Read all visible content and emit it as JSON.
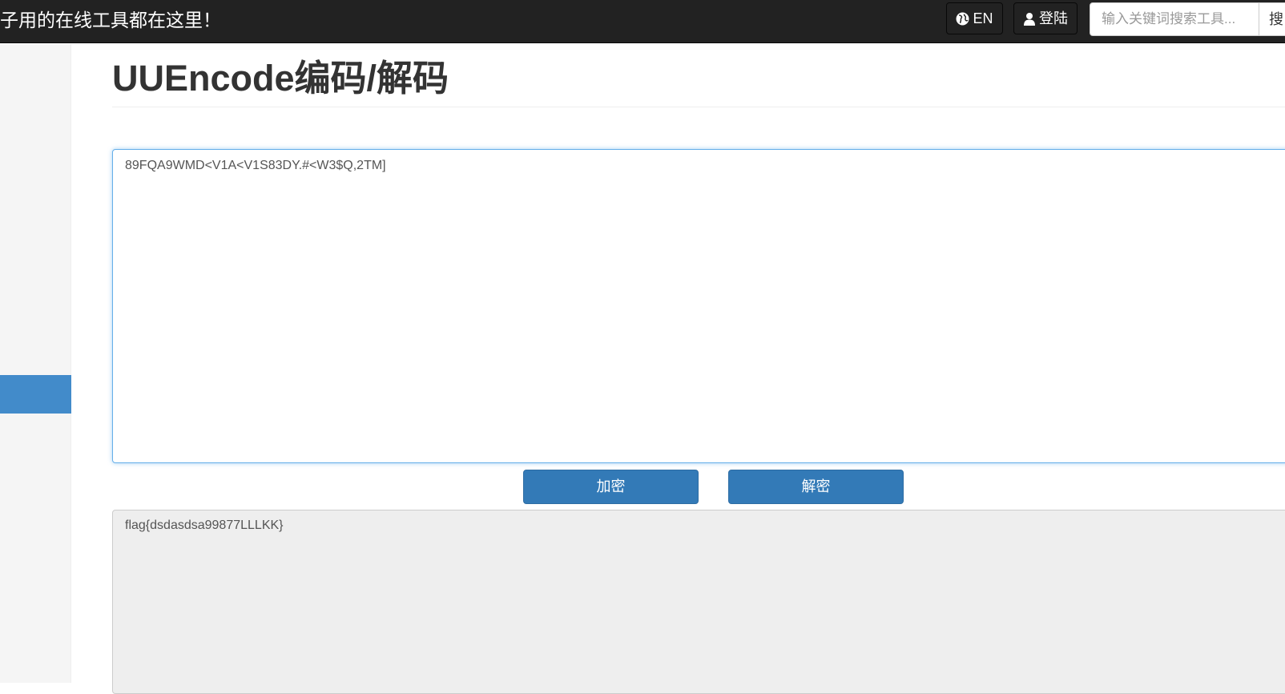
{
  "navbar": {
    "slogan": "子用的在线工具都在这里！",
    "lang_label": "EN",
    "login_label": "登陆",
    "search": {
      "placeholder": "输入关键词搜索工具...",
      "button_label": "搜"
    },
    "lang_icon": "globe-icon",
    "login_icon": "user-icon"
  },
  "page": {
    "title": "UUEncode编码/解码"
  },
  "input": {
    "value": "89FQA9WMD<V1A<V1S83DY.#<W3$Q,2TM]"
  },
  "buttons": {
    "encrypt_label": "加密",
    "decrypt_label": "解密"
  },
  "output": {
    "value": "flag{dsdasdsa99877LLLKK}"
  },
  "colors": {
    "navbar_bg": "#222222",
    "primary": "#337ab7",
    "sidebar_active": "#428bca",
    "focus_border": "#66afe9",
    "output_bg": "#eeeeee"
  }
}
